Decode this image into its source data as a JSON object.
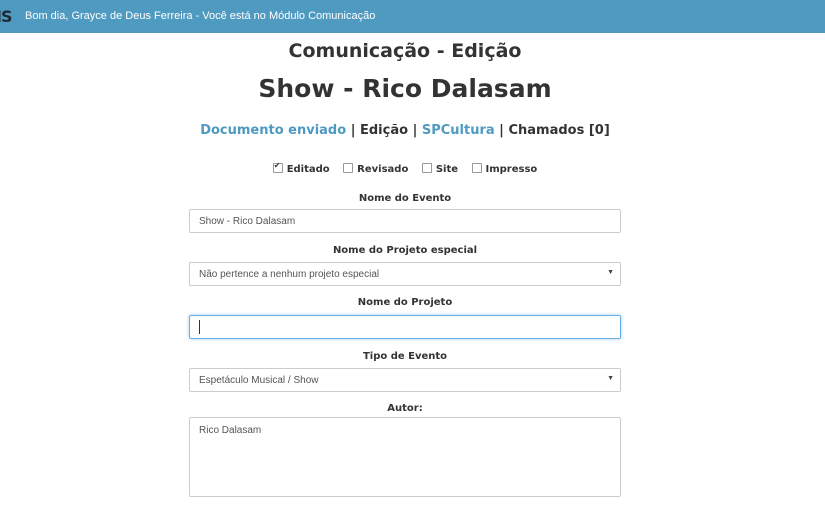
{
  "topbar": {
    "brand": "IS",
    "greeting": "Bom dia, Grayce de Deus Ferreira - Você está no Módulo Comunicação"
  },
  "page": {
    "module_title": "Comunicação - Edição",
    "event_title": "Show - Rico Dalasam"
  },
  "nav": {
    "documento": "Documento enviado",
    "sep1": " | ",
    "edicao": "Edição",
    "sep2": " | ",
    "spcultura": "SPCultura",
    "sep3": " | ",
    "chamados": "Chamados [0]"
  },
  "checkboxes": [
    {
      "label": "Editado",
      "checked": true
    },
    {
      "label": "Revisado",
      "checked": false
    },
    {
      "label": "Site",
      "checked": false
    },
    {
      "label": "Impresso",
      "checked": false
    }
  ],
  "form": {
    "nome_evento": {
      "label": "Nome do Evento",
      "value": "Show - Rico Dalasam"
    },
    "projeto_especial": {
      "label": "Nome do Projeto especial",
      "value": "Não pertence a nenhum projeto especial"
    },
    "nome_projeto": {
      "label": "Nome do Projeto",
      "value": ""
    },
    "tipo_evento": {
      "label": "Tipo de Evento",
      "value": "Espetáculo Musical / Show"
    },
    "autor": {
      "label": "Autor:",
      "value": "Rico Dalasam"
    }
  },
  "colors": {
    "topbar": "#4f9ac0",
    "link": "#4f9ac0",
    "focus": "#66afe9"
  }
}
